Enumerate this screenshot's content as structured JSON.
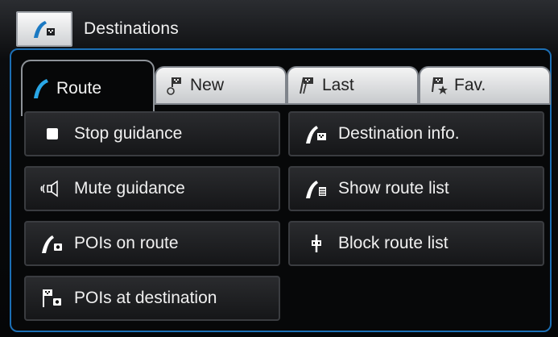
{
  "header": {
    "title": "Destinations",
    "icon": "destination-flag-icon"
  },
  "tabs": [
    {
      "label": "Route",
      "icon": "route-icon",
      "active": true
    },
    {
      "label": "New",
      "icon": "new-destination-icon",
      "active": false
    },
    {
      "label": "Last",
      "icon": "last-destinations-icon",
      "active": false
    },
    {
      "label": "Fav.",
      "icon": "favorites-icon",
      "active": false
    }
  ],
  "buttons": {
    "stop_guidance": {
      "label": "Stop guidance",
      "icon": "stop-icon"
    },
    "destination_info": {
      "label": "Destination info.",
      "icon": "destination-info-icon"
    },
    "mute_guidance": {
      "label": "Mute guidance",
      "icon": "mute-speaker-icon"
    },
    "show_route_list": {
      "label": "Show route list",
      "icon": "route-list-icon"
    },
    "pois_on_route": {
      "label": "POIs on route",
      "icon": "pois-route-icon"
    },
    "block_route_list": {
      "label": "Block route list",
      "icon": "block-route-icon"
    },
    "pois_at_destination": {
      "label": "POIs at destination",
      "icon": "pois-destination-icon"
    }
  },
  "colors": {
    "accent": "#1c6fb5",
    "route_icon": "#2aa7e6"
  }
}
